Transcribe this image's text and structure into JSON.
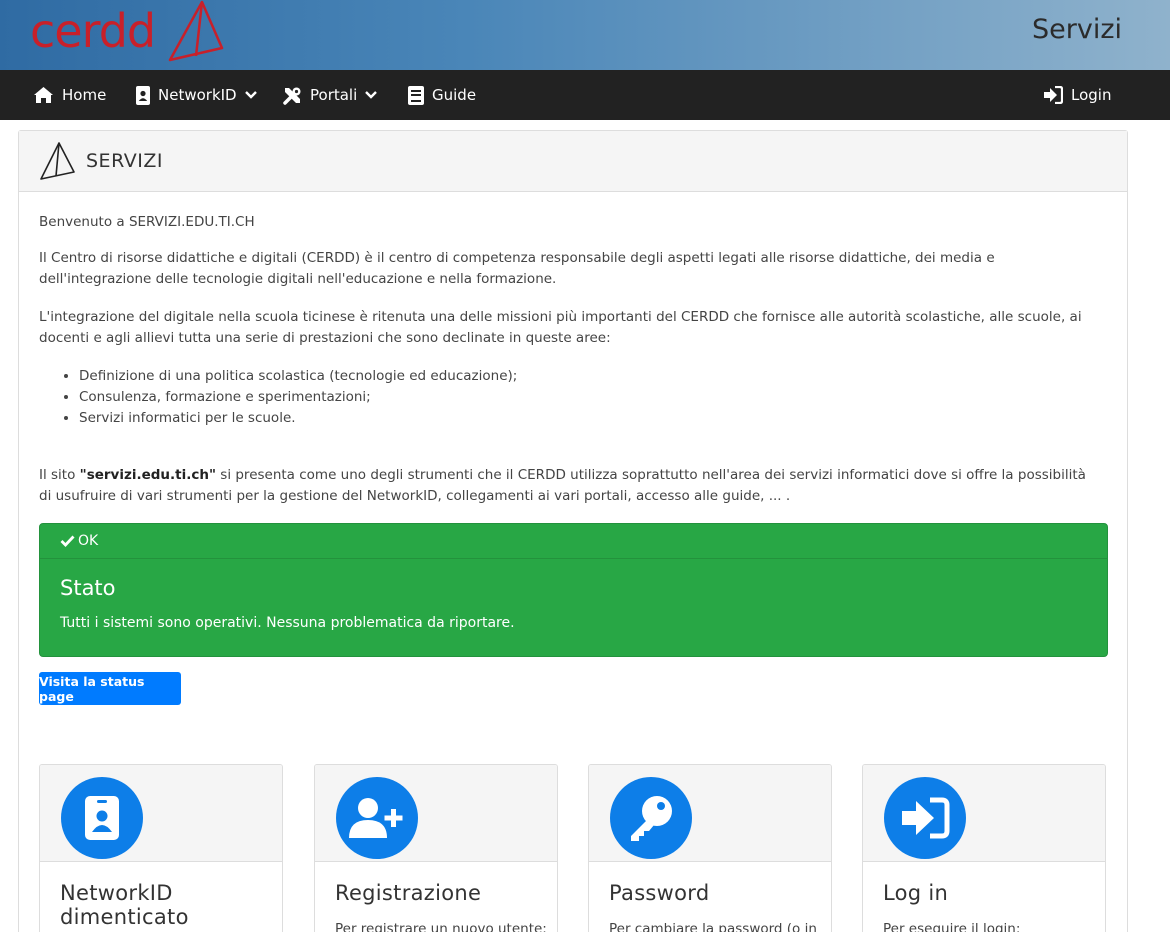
{
  "banner": {
    "logo_text": "cerdd",
    "title": "Servizi"
  },
  "nav": {
    "home": "Home",
    "networkid": "NetworkID",
    "portali": "Portali",
    "guide": "Guide",
    "login": "Login"
  },
  "card": {
    "title": "SERVIZI",
    "welcome": "Benvenuto a SERVIZI.EDU.TI.CH",
    "para1": "Il Centro di risorse didattiche e digitali (CERDD) è il centro di competenza responsabile degli aspetti legati alle risorse didattiche, dei media e dell'integrazione delle tecnologie digitali nell'educazione e nella formazione.",
    "para2": "L'integrazione del digitale nella scuola ticinese è ritenuta una delle missioni più importanti del CERDD che fornisce alle autorità scolastiche, alle scuole, ai docenti e agli allievi tutta una serie di prestazioni che sono declinate in queste aree:",
    "bullets": [
      "Definizione di una politica scolastica (tecnologie ed educazione);",
      "Consulenza, formazione e sperimentazioni;",
      "Servizi informatici per le scuole."
    ],
    "para3_prefix": "Il sito ",
    "para3_site": "\"servizi.edu.ti.ch\"",
    "para3_rest": " si presenta come uno degli strumenti che il CERDD utilizza soprattutto nell'area dei servizi informatici dove si offre la possibilità di usufruire di vari strumenti per la gestione del NetworkID, collegamenti ai vari portali, accesso alle guide, ... ."
  },
  "status": {
    "badge": "OK",
    "title": "Stato",
    "message": "Tutti i sistemi sono operativi. Nessuna problematica da riportare.",
    "button": "Visita la status page",
    "color": "#28a745"
  },
  "tiles": [
    {
      "title": "NetworkID dimenticato",
      "desc": "",
      "icon": "id-badge-icon"
    },
    {
      "title": "Registrazione",
      "desc": "Per registrare un nuovo utente:",
      "icon": "user-plus-icon"
    },
    {
      "title": "Password",
      "desc": "Per cambiare la password (o in",
      "icon": "key-icon"
    },
    {
      "title": "Log in",
      "desc": "Per eseguire il login:",
      "icon": "sign-in-icon"
    }
  ],
  "colors": {
    "nav_bg": "#222222",
    "accent": "#0d7ee8",
    "button": "#007bff",
    "brand": "#c8202a"
  }
}
